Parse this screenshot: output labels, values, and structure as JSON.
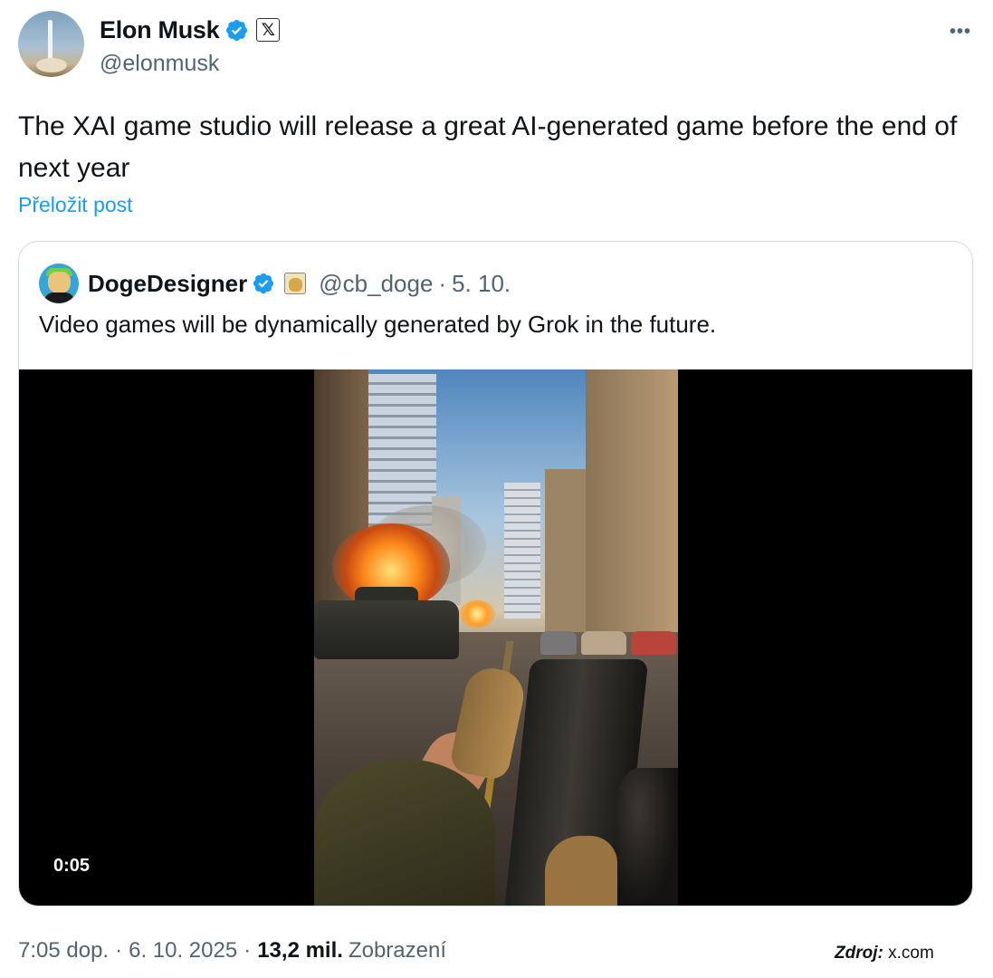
{
  "author": {
    "name": "Elon Musk",
    "handle": "@elonmusk",
    "x_badge": "𝕏",
    "verified_color": "#1d9bf0"
  },
  "more_menu": "•••",
  "tweet": {
    "text": "The XAI game studio will release a great AI-generated game before the end of next year",
    "translate_label": "Přeložit post"
  },
  "quote": {
    "name": "DogeDesigner",
    "handle": "@cb_doge",
    "separator": "·",
    "date": "5. 10.",
    "text": "Video games will be dynamically generated by Grok in the future.",
    "video": {
      "duration": "0:05"
    }
  },
  "footer": {
    "time": "7:05 dop.",
    "sep1": "·",
    "date": "6. 10. 2025",
    "sep2": "·",
    "views_count": "13,2 mil.",
    "views_label": "Zobrazení"
  },
  "source": {
    "label": "Zdroj:",
    "value": "x.com"
  },
  "icons": {
    "verified": "verified-badge-icon",
    "more": "more-horizontal-icon",
    "doge_badge": "doge-affiliate-badge-icon"
  }
}
